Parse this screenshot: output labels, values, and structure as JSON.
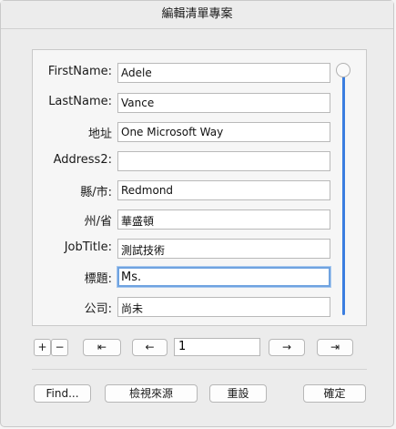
{
  "window": {
    "title": "編輯清單專案"
  },
  "form": {
    "fields": [
      {
        "label": "FirstName:",
        "value": "Adele"
      },
      {
        "label": "LastName:",
        "value": "Vance"
      },
      {
        "label": "地址",
        "value": "One Microsoft Way"
      },
      {
        "label": "Address2:",
        "value": ""
      },
      {
        "label": "縣/市:",
        "value": "Redmond"
      },
      {
        "label": "州/省",
        "value": "華盛頓"
      },
      {
        "label": "JobTitle:",
        "value": "測試技術"
      },
      {
        "label": "標題:",
        "value": "Ms."
      },
      {
        "label": "公司:",
        "value": "尚未"
      }
    ],
    "scroll_position": 0.0
  },
  "nav": {
    "add_label": "+",
    "remove_label": "−",
    "first_label": "⇤",
    "prev_label": "←",
    "record_number": "1",
    "next_label": "→",
    "last_label": "⇥"
  },
  "footer": {
    "find_label": "Find...",
    "view_source_label": "檢視來源",
    "reset_label": "重設",
    "ok_label": "確定"
  }
}
